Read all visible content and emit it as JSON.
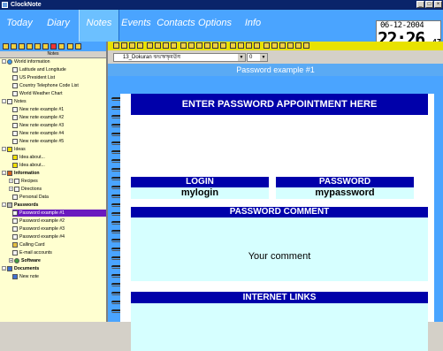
{
  "window": {
    "title": "ClockNote"
  },
  "nav": {
    "tabs": [
      "Today",
      "Diary",
      "Notes",
      "Events",
      "Contacts",
      "Options",
      "Info"
    ],
    "active": "Notes"
  },
  "clock": {
    "date": "06-12-2004",
    "time": "22:26",
    "seconds": "47"
  },
  "left_panel": {
    "header": "Notes",
    "tree": [
      {
        "label": "World information",
        "icon": "globe-icon"
      },
      {
        "label": "Latitude and Longitude",
        "icon": "note-icon"
      },
      {
        "label": "US President List",
        "icon": "note-icon"
      },
      {
        "label": "Country Telephone Code List",
        "icon": "note-icon"
      },
      {
        "label": "World Weather Chart",
        "icon": "note-icon"
      },
      {
        "label": "Notes",
        "icon": "note-icon"
      },
      {
        "label": "New note example #1",
        "icon": "note-icon"
      },
      {
        "label": "New note example #2",
        "icon": "note-icon"
      },
      {
        "label": "New note example #3",
        "icon": "note-icon"
      },
      {
        "label": "New note example #4",
        "icon": "note-icon"
      },
      {
        "label": "New note example #5",
        "icon": "note-icon"
      },
      {
        "label": "Ideas",
        "icon": "warning-icon"
      },
      {
        "label": "Idea about...",
        "icon": "warning-icon"
      },
      {
        "label": "Idea about...",
        "icon": "warning-icon"
      },
      {
        "label": "Information",
        "icon": "book-icon"
      },
      {
        "label": "Recipes",
        "icon": "note-icon"
      },
      {
        "label": "Directions",
        "icon": "note-icon"
      },
      {
        "label": "Personal Data",
        "icon": "note-icon"
      },
      {
        "label": "Passwords",
        "icon": "lock-icon"
      },
      {
        "label": "Password example #1",
        "icon": "note-icon"
      },
      {
        "label": "Password example #2",
        "icon": "note-icon"
      },
      {
        "label": "Password example #3",
        "icon": "note-icon"
      },
      {
        "label": "Password example #4",
        "icon": "note-icon"
      },
      {
        "label": "Calling Card",
        "icon": "card-icon"
      },
      {
        "label": "E-mail accounts",
        "icon": "note-icon"
      },
      {
        "label": "Software",
        "icon": "software-icon"
      },
      {
        "label": "Documents",
        "icon": "computer-icon"
      },
      {
        "label": "New note",
        "icon": "computer-icon"
      }
    ]
  },
  "editor": {
    "font_name": "13_Dokuran",
    "font_sample": "ঝভঋৠমঊষ",
    "font_size": "0",
    "note_title": "Password example #1",
    "header": "ENTER PASSWORD APPOINTMENT HERE",
    "login_label": "LOGIN",
    "login_value": "mylogin",
    "password_label": "PASSWORD",
    "password_value": "mypassword",
    "comment_label": "PASSWORD COMMENT",
    "comment_value": "Your comment",
    "links_label": "INTERNET LINKS"
  },
  "colors": {
    "nav_blue": "#4aa4ff",
    "heading_navy": "#0000aa",
    "cell_cyan": "#d6ffff",
    "tree_bg": "#ffffd0",
    "selection": "#6a1abf"
  }
}
